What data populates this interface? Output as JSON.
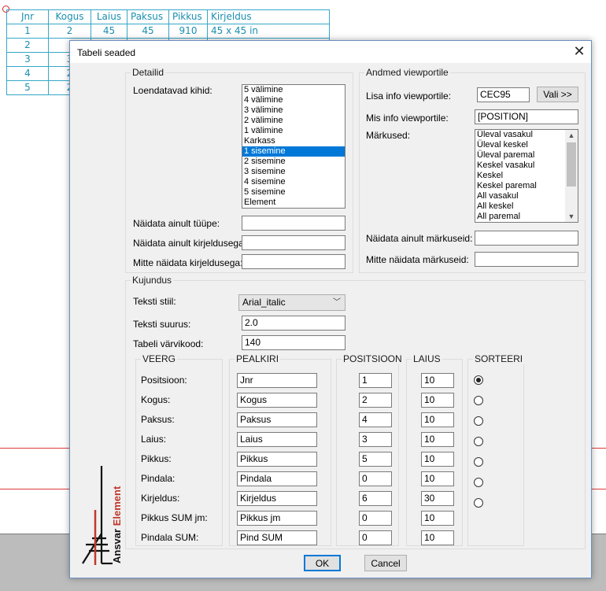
{
  "background_table": {
    "headers": [
      "Jnr",
      "Kogus",
      "Laius",
      "Paksus",
      "Pikkus",
      "Kirjeldus"
    ],
    "rows": [
      [
        "1",
        "2",
        "45",
        "45",
        "910",
        "45 x 45 in"
      ],
      [
        "2",
        "",
        "",
        "",
        "",
        ""
      ],
      [
        "3",
        "3",
        "",
        "",
        "",
        ""
      ],
      [
        "4",
        "2",
        "",
        "",
        "",
        ""
      ],
      [
        "5",
        "2",
        "",
        "",
        "",
        ""
      ]
    ]
  },
  "dialog": {
    "title": "Tabeli seaded",
    "close_glyph": "✕",
    "detailid": {
      "legend": "Detailid",
      "layers_label": "Loendatavad kihid:",
      "layers": [
        "5 välimine",
        "4 välimine",
        "3 välimine",
        "2 välimine",
        "1 välimine",
        "Karkass",
        "1 sisemine",
        "2 sisemine",
        "3 sisemine",
        "4 sisemine",
        "5 sisemine",
        "Element"
      ],
      "selected_layer": "1 sisemine",
      "only_type_label": "Näidata ainult tüüpe:",
      "only_type_value": "",
      "only_desc_label": "Näidata ainult kirjeldusega:",
      "only_desc_value": "",
      "not_desc_label": "Mitte näidata kirjeldusega:",
      "not_desc_value": ""
    },
    "viewport": {
      "legend": "Andmed viewportile",
      "add_info_label": "Lisa info viewportile:",
      "add_info_value": "CEC95",
      "select_button": "Vali >>",
      "which_info_label": "Mis info viewportile:",
      "which_info_value": "[POSITION]",
      "marks_label": "Märkused:",
      "marks": [
        "Üleval vasakul",
        "Üleval keskel",
        "Üleval paremal",
        "Keskel vasakul",
        "Keskel",
        "Keskel paremal",
        "All vasakul",
        "All keskel",
        "All paremal"
      ],
      "only_marks_label": "Näidata ainult märkuseid:",
      "only_marks_value": "",
      "not_marks_label": "Mitte näidata märkuseid:",
      "not_marks_value": ""
    },
    "kujundus": {
      "legend": "Kujundus",
      "text_style_label": "Teksti stiil:",
      "text_style_value": "Arial_italic",
      "text_size_label": "Teksti suurus:",
      "text_size_value": "2.0",
      "color_label": "Tabeli värvikood:",
      "color_value": "140",
      "col_headers": {
        "veerg": "VEERG",
        "pealkiri": "PEALKIRI",
        "positsioon": "POSITSIOON",
        "laius": "LAIUS",
        "sorteeri": "SORTEERI"
      },
      "rows": [
        {
          "label": "Positsioon:",
          "title": "Jnr",
          "position": "1",
          "width": "10"
        },
        {
          "label": "Kogus:",
          "title": "Kogus",
          "position": "2",
          "width": "10"
        },
        {
          "label": "Paksus:",
          "title": "Paksus",
          "position": "4",
          "width": "10"
        },
        {
          "label": "Laius:",
          "title": "Laius",
          "position": "3",
          "width": "10"
        },
        {
          "label": "Pikkus:",
          "title": "Pikkus",
          "position": "5",
          "width": "10"
        },
        {
          "label": "Pindala:",
          "title": "Pindala",
          "position": "0",
          "width": "10"
        },
        {
          "label": "Kirjeldus:",
          "title": "Kirjeldus",
          "position": "6",
          "width": "30"
        },
        {
          "label": "Pikkus SUM jm:",
          "title": "Pikkus jm",
          "position": "0",
          "width": "10"
        },
        {
          "label": "Pindala SUM:",
          "title": "Pind SUM",
          "position": "0",
          "width": "10"
        }
      ],
      "sort_selected_row": "Positsioon:"
    },
    "logo_text": "Ansvar Element",
    "ok_button": "OK",
    "cancel_button": "Cancel"
  },
  "colors": {
    "cad_table": "#1a8fb0",
    "cad_lines": "#e03a3a",
    "selection": "#0078d7",
    "logo_red": "#c0392b"
  }
}
